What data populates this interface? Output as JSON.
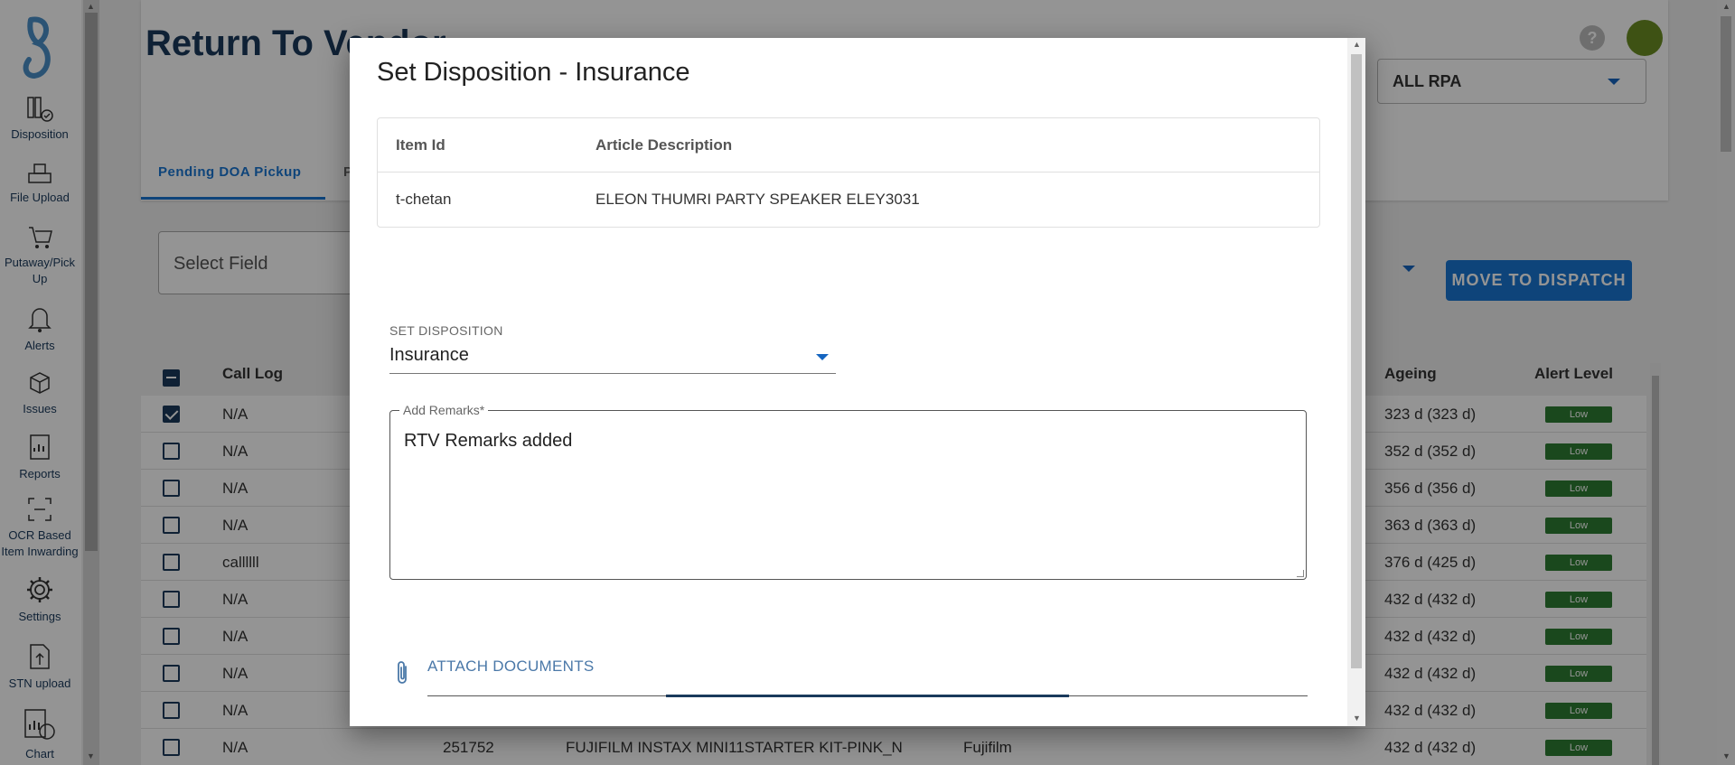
{
  "sidebar": {
    "items": [
      {
        "label": "Disposition"
      },
      {
        "label": "File Upload"
      },
      {
        "label": "Putaway/Pick Up"
      },
      {
        "label": "Alerts"
      },
      {
        "label": "Issues"
      },
      {
        "label": "Reports"
      },
      {
        "label": "OCR Based Item Inwarding"
      },
      {
        "label": "Settings"
      },
      {
        "label": "STN upload"
      },
      {
        "label": "Chart"
      }
    ]
  },
  "header": {
    "title": "Return To Vendor",
    "help": "?",
    "rpa_select": "ALL RPA"
  },
  "tabs": [
    {
      "label": "Pending DOA Pickup"
    },
    {
      "label": "P"
    }
  ],
  "filters": {
    "select_field": "Select Field",
    "move_button": "MOVE TO DISPATCH"
  },
  "table": {
    "headers": {
      "call_log": "Call Log",
      "ageing": "Ageing",
      "alert_level": "Alert Level"
    },
    "rows": [
      {
        "checked": true,
        "call_log": "N/A",
        "ageing": "323 d (323 d)",
        "alert": "Low"
      },
      {
        "checked": false,
        "call_log": "N/A",
        "ageing": "352 d (352 d)",
        "alert": "Low"
      },
      {
        "checked": false,
        "call_log": "N/A",
        "ageing": "356 d (356 d)",
        "alert": "Low"
      },
      {
        "checked": false,
        "call_log": "N/A",
        "ageing": "363 d (363 d)",
        "alert": "Low"
      },
      {
        "checked": false,
        "call_log": "callllll",
        "ageing": "376 d (425 d)",
        "alert": "Low"
      },
      {
        "checked": false,
        "call_log": "N/A",
        "ageing": "432 d (432 d)",
        "alert": "Low"
      },
      {
        "checked": false,
        "call_log": "N/A",
        "ageing": "432 d (432 d)",
        "alert": "Low"
      },
      {
        "checked": false,
        "call_log": "N/A",
        "ageing": "432 d (432 d)",
        "alert": "Low"
      },
      {
        "checked": false,
        "call_log": "N/A",
        "ageing": "432 d (432 d)",
        "alert": "Low"
      },
      {
        "checked": false,
        "call_log": "N/A",
        "item": "251752",
        "description": "FUJIFILM INSTAX MINI11STARTER KIT-PINK_N",
        "brand": "Fujifilm",
        "ageing": "432 d (432 d)",
        "alert": "Low"
      }
    ]
  },
  "modal": {
    "title": "Set Disposition - Insurance",
    "table_headers": {
      "item_id": "Item Id",
      "description": "Article Description"
    },
    "item": {
      "id": "t-chetan",
      "description": "ELEON THUMRI PARTY SPEAKER ELEY3031"
    },
    "disposition_label": "SET DISPOSITION",
    "disposition_value": "Insurance",
    "remarks_label": "Add Remarks*",
    "remarks_value": "RTV Remarks added",
    "attach_label": "ATTACH DOCUMENTS"
  }
}
